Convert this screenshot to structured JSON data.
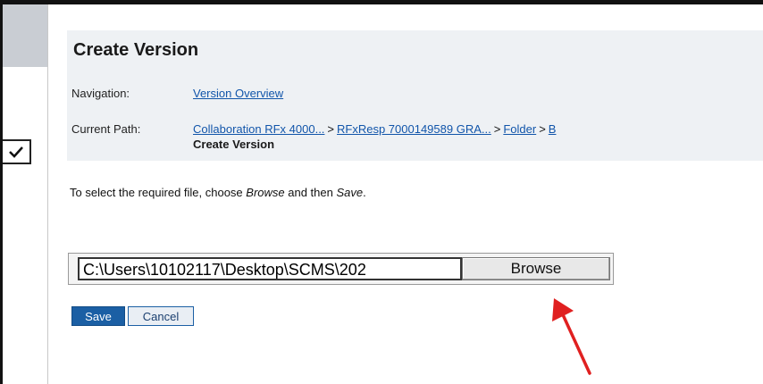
{
  "header": {
    "title": "Create Version"
  },
  "navigation": {
    "label": "Navigation:",
    "link": "Version Overview"
  },
  "current_path": {
    "label": "Current Path:",
    "items": [
      "Collaboration RFx 4000...",
      "RFxResp 7000149589 GRA...",
      "Folder",
      "B"
    ],
    "separator": ">",
    "current": "Create Version"
  },
  "instructions": {
    "prefix": "To select the required file, choose ",
    "browse_word": "Browse",
    "middle": " and then ",
    "save_word": "Save",
    "suffix": "."
  },
  "file_upload": {
    "value": "C:\\Users\\10102117\\Desktop\\SCMS\\202",
    "browse_label": "Browse"
  },
  "actions": {
    "save_label": "Save",
    "cancel_label": "Cancel"
  },
  "colors": {
    "panel_bg": "#eef1f4",
    "link": "#1155aa",
    "primary_button": "#1b5fa4",
    "annotation_arrow": "#e02020"
  }
}
